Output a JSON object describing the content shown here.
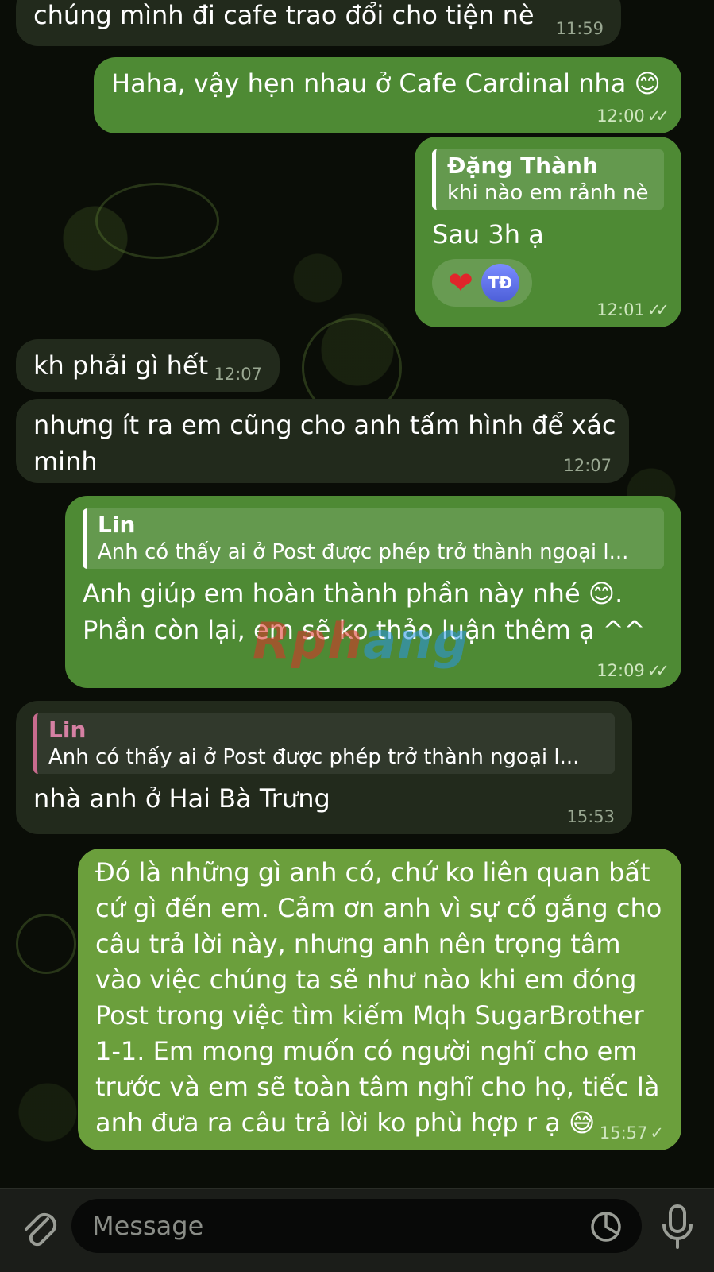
{
  "messages": [
    {
      "text": "chúng mình đi cafe trao đổi cho tiện nè",
      "time": "11:59"
    },
    {
      "text": "Haha, vậy hẹn nhau ở Cafe Cardinal nha 😊",
      "time": "12:00"
    },
    {
      "reply_name": "Đặng Thành",
      "reply_text": "khi nào em rảnh nè",
      "text": "Sau 3h ạ",
      "reaction_emoji": "❤️",
      "reaction_user": "TĐ",
      "time": "12:01"
    },
    {
      "text": "kh phải gì hết",
      "time": "12:07"
    },
    {
      "text": "nhưng ít ra em cũng cho anh tấm hình để xác minh",
      "time": "12:07"
    },
    {
      "reply_name": "Lin",
      "reply_text": "Anh có thấy ai ở Post được phép trở thành ngoại l...",
      "text": "Anh giúp em hoàn thành phần này nhé 😊. Phần còn lại, em sẽ ko thảo luận thêm ạ ^^",
      "time": "12:09"
    },
    {
      "reply_name": "Lin",
      "reply_text": "Anh có thấy ai ở Post được phép trở thành ngoại l...",
      "text": "nhà anh ở Hai Bà Trưng",
      "time": "15:53"
    },
    {
      "text": "Đó là những gì anh có, chứ ko liên quan bất cứ gì đến em. Cảm ơn anh vì sự cố gắng cho câu trả lời này, nhưng anh nên trọng tâm vào việc chúng ta sẽ như nào khi em đóng Post trong việc tìm kiếm Mqh SugarBrother 1-1. Em mong muốn có người nghĩ cho em trước và em sẽ toàn tâm nghĩ cho họ, tiếc là anh đưa ra câu trả lời ko phù hợp r ạ 😅",
      "time": "15:57"
    }
  ],
  "watermark": {
    "part1": "Rph",
    "part2": "ang"
  },
  "composer": {
    "placeholder": "Message"
  },
  "icons": {
    "attach": "paperclip-icon",
    "sticker": "sticker-icon",
    "mic": "microphone-icon",
    "read": "double-check-icon",
    "sent": "check-icon"
  },
  "colors": {
    "incoming": "#222a1c",
    "outgoing": "#4e8a34",
    "outgoing_light": "#6b9f3c"
  }
}
